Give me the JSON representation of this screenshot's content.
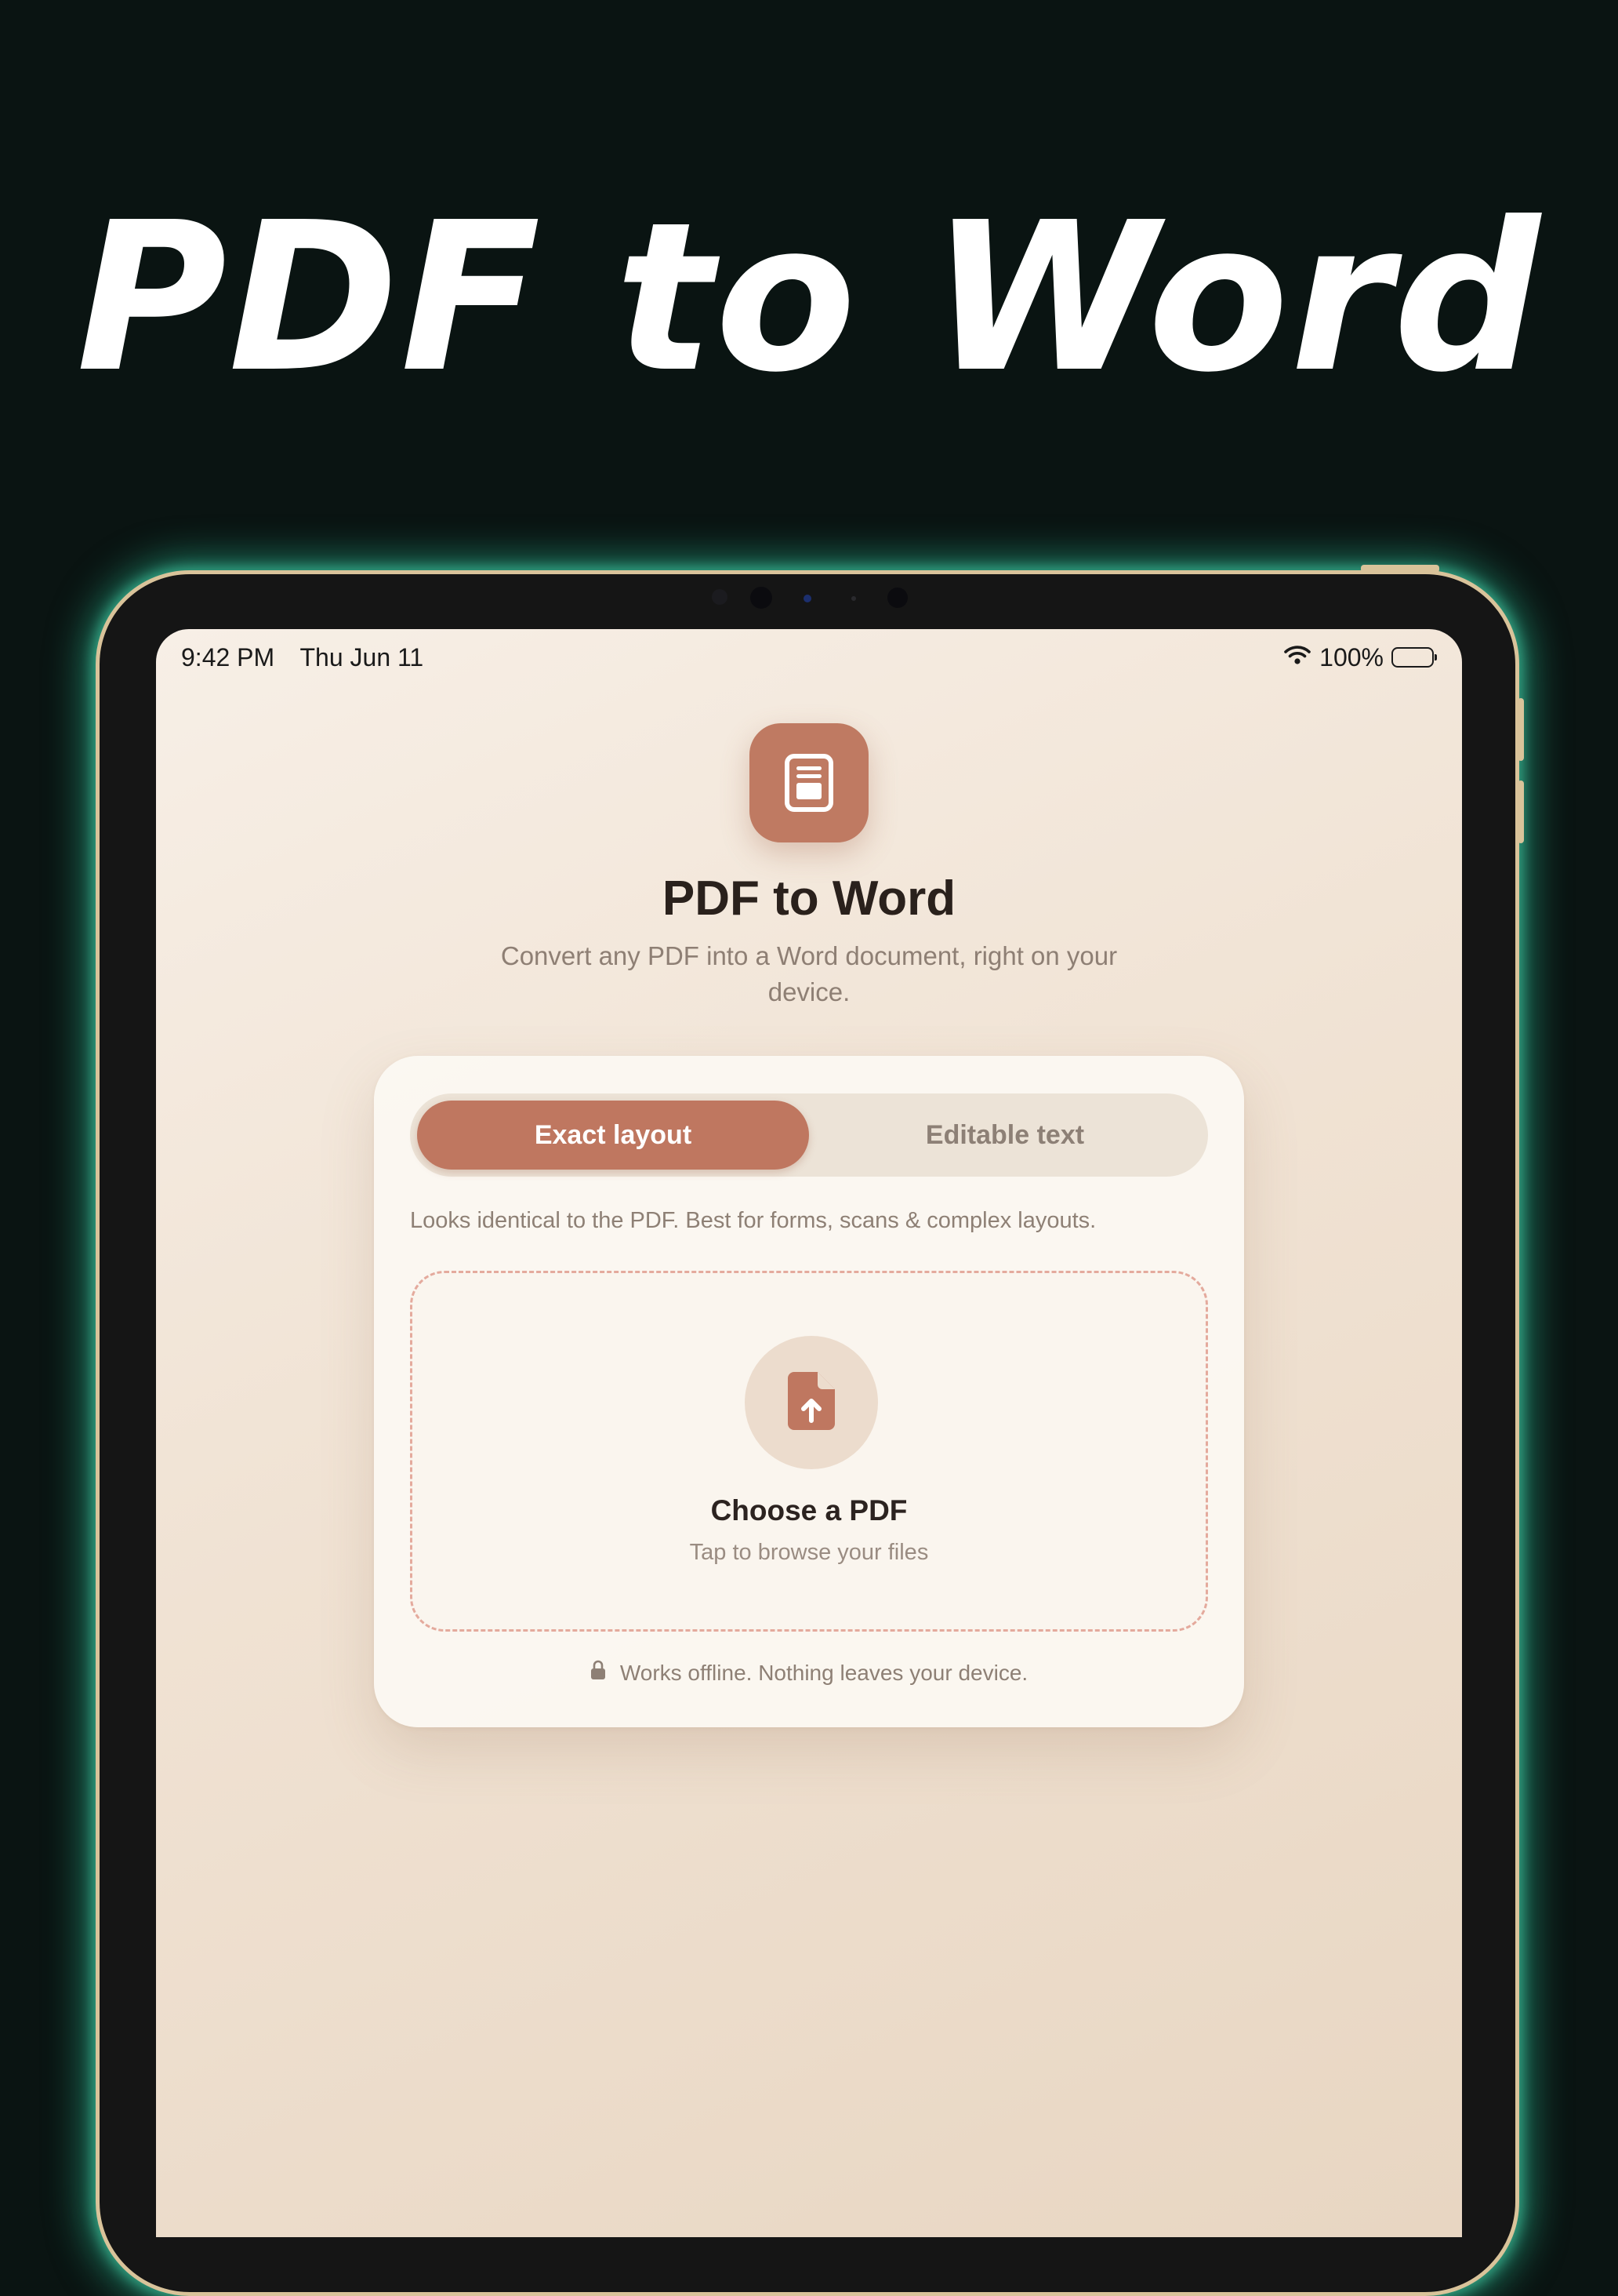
{
  "marketing": {
    "headline": "PDF to Word"
  },
  "status_bar": {
    "time": "9:42 PM",
    "date": "Thu Jun 11",
    "battery": "100%",
    "icons": [
      "wifi-icon",
      "battery-icon"
    ]
  },
  "app": {
    "icon": "document-icon",
    "title": "PDF to Word",
    "subtitle": "Convert any PDF into a Word document, right on your device."
  },
  "mode_picker": {
    "options": [
      "Exact layout",
      "Editable text"
    ],
    "selected": "Exact layout",
    "description": "Looks identical to the PDF. Best for forms, scans & complex layouts."
  },
  "dropzone": {
    "icon": "file-upload-icon",
    "title": "Choose a PDF",
    "hint": "Tap to browse your files"
  },
  "footer": {
    "icon": "lock-icon",
    "note": "Works offline. Nothing leaves your device."
  },
  "colors": {
    "accent": "#bf7760",
    "background": "#0a1412",
    "glow": "#2bbe96"
  }
}
